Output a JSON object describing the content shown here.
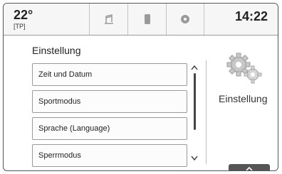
{
  "status": {
    "temperature": "22°",
    "source": "[TP]",
    "time": "14:22"
  },
  "toolbar": {
    "icons": [
      "audio-icon",
      "phone-icon",
      "app-icon"
    ]
  },
  "main": {
    "title": "Einstellung",
    "items": [
      {
        "label": "Zeit und Datum"
      },
      {
        "label": "Sportmodus"
      },
      {
        "label": "Sprache (Language)"
      },
      {
        "label": "Sperrmodus"
      }
    ]
  },
  "side_panel": {
    "label": "Einstellung",
    "icon": "gears-icon"
  },
  "bottom_tab": {
    "icon": "chevron-up-icon"
  }
}
